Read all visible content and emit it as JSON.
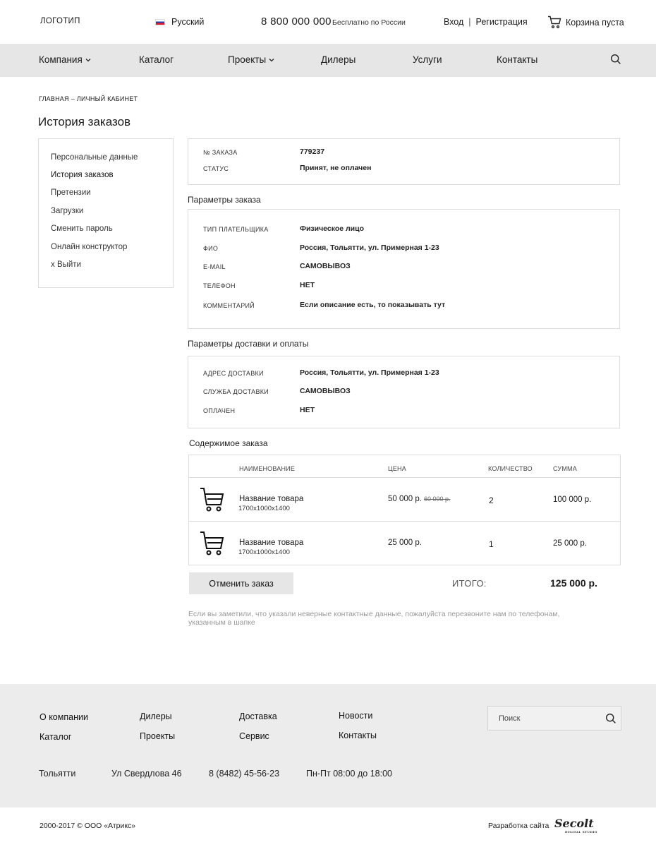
{
  "header": {
    "logo": "ЛОГОТИП",
    "language": "Русский",
    "phone": "8 800 000 000",
    "phone_note": "Бесплатно по России",
    "login": "Вход",
    "separator": "|",
    "register": "Регистрация",
    "cart": "Корзина пуста"
  },
  "nav": {
    "items": [
      {
        "label": "Компания",
        "has_dropdown": true
      },
      {
        "label": "Каталог"
      },
      {
        "label": "Проекты",
        "has_dropdown": true
      },
      {
        "label": "Дилеры"
      },
      {
        "label": "Услуги"
      },
      {
        "label": "Контакты"
      }
    ],
    "search_icon": "search-icon"
  },
  "breadcrumb": {
    "home": "ГЛАВНАЯ",
    "separator": "–",
    "current": "ЛИЧНЫЙ КАБИНЕТ"
  },
  "page_title": "История заказов",
  "sidebar": {
    "items": [
      {
        "label": "Персональные данные"
      },
      {
        "label": "История заказов",
        "active": true
      },
      {
        "label": "Претензии"
      },
      {
        "label": "Загрузки"
      },
      {
        "label": "Сменить пароль"
      },
      {
        "label": "Онлайн конструктор"
      },
      {
        "label": "x Выйти"
      }
    ]
  },
  "order": {
    "number_label": "№ ЗАКАЗА",
    "number": "779237",
    "status_label": "СТАТУС",
    "status": "Принят, не оплачен"
  },
  "params": {
    "title": "Параметры заказа",
    "rows": [
      {
        "label": "ТИП ПЛАТЕЛЬЩИКА",
        "value": "Физическое лицо"
      },
      {
        "label": "ФИО",
        "value": "Россия, Тольятти, ул. Примерная 1-23"
      },
      {
        "label": "E-MAIL",
        "value": "САМОВЫВОЗ"
      },
      {
        "label": "ТЕЛЕФОН",
        "value": "НЕТ"
      },
      {
        "label": "КОММЕНТАРИЙ",
        "value": "Если описание есть, то показывать тут"
      }
    ]
  },
  "delivery": {
    "title": "Параметры доставки и оплаты",
    "rows": [
      {
        "label": "АДРЕС ДОСТАВКИ",
        "value": "Россия, Тольятти, ул. Примерная 1-23"
      },
      {
        "label": "СЛУЖБА ДОСТАВКИ",
        "value": "САМОВЫВОЗ"
      },
      {
        "label": "ОПЛАЧЕН",
        "value": "НЕТ"
      }
    ]
  },
  "contents": {
    "title": "Содержимое заказа",
    "columns": {
      "name": "НАИМЕНОВАНИЕ",
      "price": "ЦЕНА",
      "qty": "КОЛИЧЕСТВО",
      "sum": "СУММА"
    },
    "items": [
      {
        "icon": "shopping-cart-icon",
        "name": "Название товара",
        "size": "1700x1000x1400",
        "price": "50 000 р.",
        "old_price": "60 000 р.",
        "qty": "2",
        "sum": "100 000 р."
      },
      {
        "icon": "shopping-cart-icon",
        "name": "Название товара",
        "size": "1700x1000x1400",
        "price": "25 000 р.",
        "old_price": "",
        "qty": "1",
        "sum": "25 000 р."
      }
    ]
  },
  "actions": {
    "cancel": "Отменить заказ",
    "total_label": "ИТОГО:",
    "total_value": "125 000 р."
  },
  "note": "Если вы заметили, что указали неверные контактные данные, пожалуйста перезвоните нам по телефонам, указанным в шапке",
  "footer": {
    "links": [
      [
        "О компании",
        "Каталог"
      ],
      [
        "Дилеры",
        "Проекты"
      ],
      [
        "Доставка",
        "Сервис"
      ],
      [
        "Новости",
        "Контакты"
      ]
    ],
    "search_placeholder": "Поиск",
    "city": "Тольятти",
    "address": "Ул Свердлова 46",
    "phone": "8 (8482) 45-56-23",
    "hours": "Пн-Пт 08:00 до 18:00",
    "copyright": "2000-2017 © ООО «Атрикс»",
    "developer_text": "Разработка сайта",
    "developer_logo": "Secolt",
    "developer_logo_sub": "DIGITAL STUDIO"
  }
}
